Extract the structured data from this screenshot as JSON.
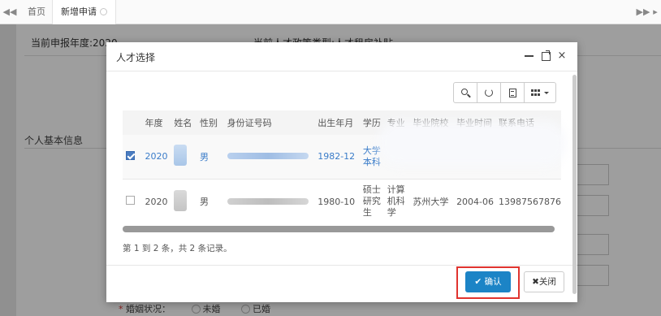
{
  "tabs": {
    "home": "首页",
    "active": "新增申请"
  },
  "background": {
    "header_year": "当前申报年度:2020",
    "header_type": "当前人才政策类型:人才租房补贴",
    "section_title": "个人基本信息",
    "marital_label": "婚姻状况：",
    "marital_options": [
      "未婚",
      "已婚"
    ]
  },
  "modal": {
    "title": "人才选择",
    "columns": [
      "年度",
      "姓名",
      "性别",
      "身份证号码",
      "出生年月",
      "学历",
      "专业",
      "毕业院校",
      "毕业时间",
      "联系电话"
    ],
    "rows": [
      {
        "checked": true,
        "year": "2020",
        "gender": "男",
        "birth": "1982-12",
        "education": [
          "大学",
          "本科"
        ],
        "major": [],
        "school": "",
        "grad_time": "",
        "phone": ""
      },
      {
        "checked": false,
        "year": "2020",
        "gender": "男",
        "birth": "1980-10",
        "education": [
          "硕士",
          "研究",
          "生"
        ],
        "major": [
          "计算",
          "机科",
          "学"
        ],
        "school": "苏州大学",
        "grad_time": "2004-06",
        "phone": "13987567876"
      }
    ],
    "page_info": "第 1 到 2 条，共 2 条记录。",
    "confirm_label": "确认",
    "close_label": "关闭"
  },
  "icons": {
    "toolbar": [
      "search-icon",
      "refresh-icon",
      "list-icon",
      "grid-icon"
    ],
    "header": [
      "minimize-icon",
      "maximize-icon",
      "close-icon"
    ]
  },
  "colors": {
    "primary": "#1c84c6",
    "highlight": "#e0342f",
    "link": "#3a7cc9"
  }
}
